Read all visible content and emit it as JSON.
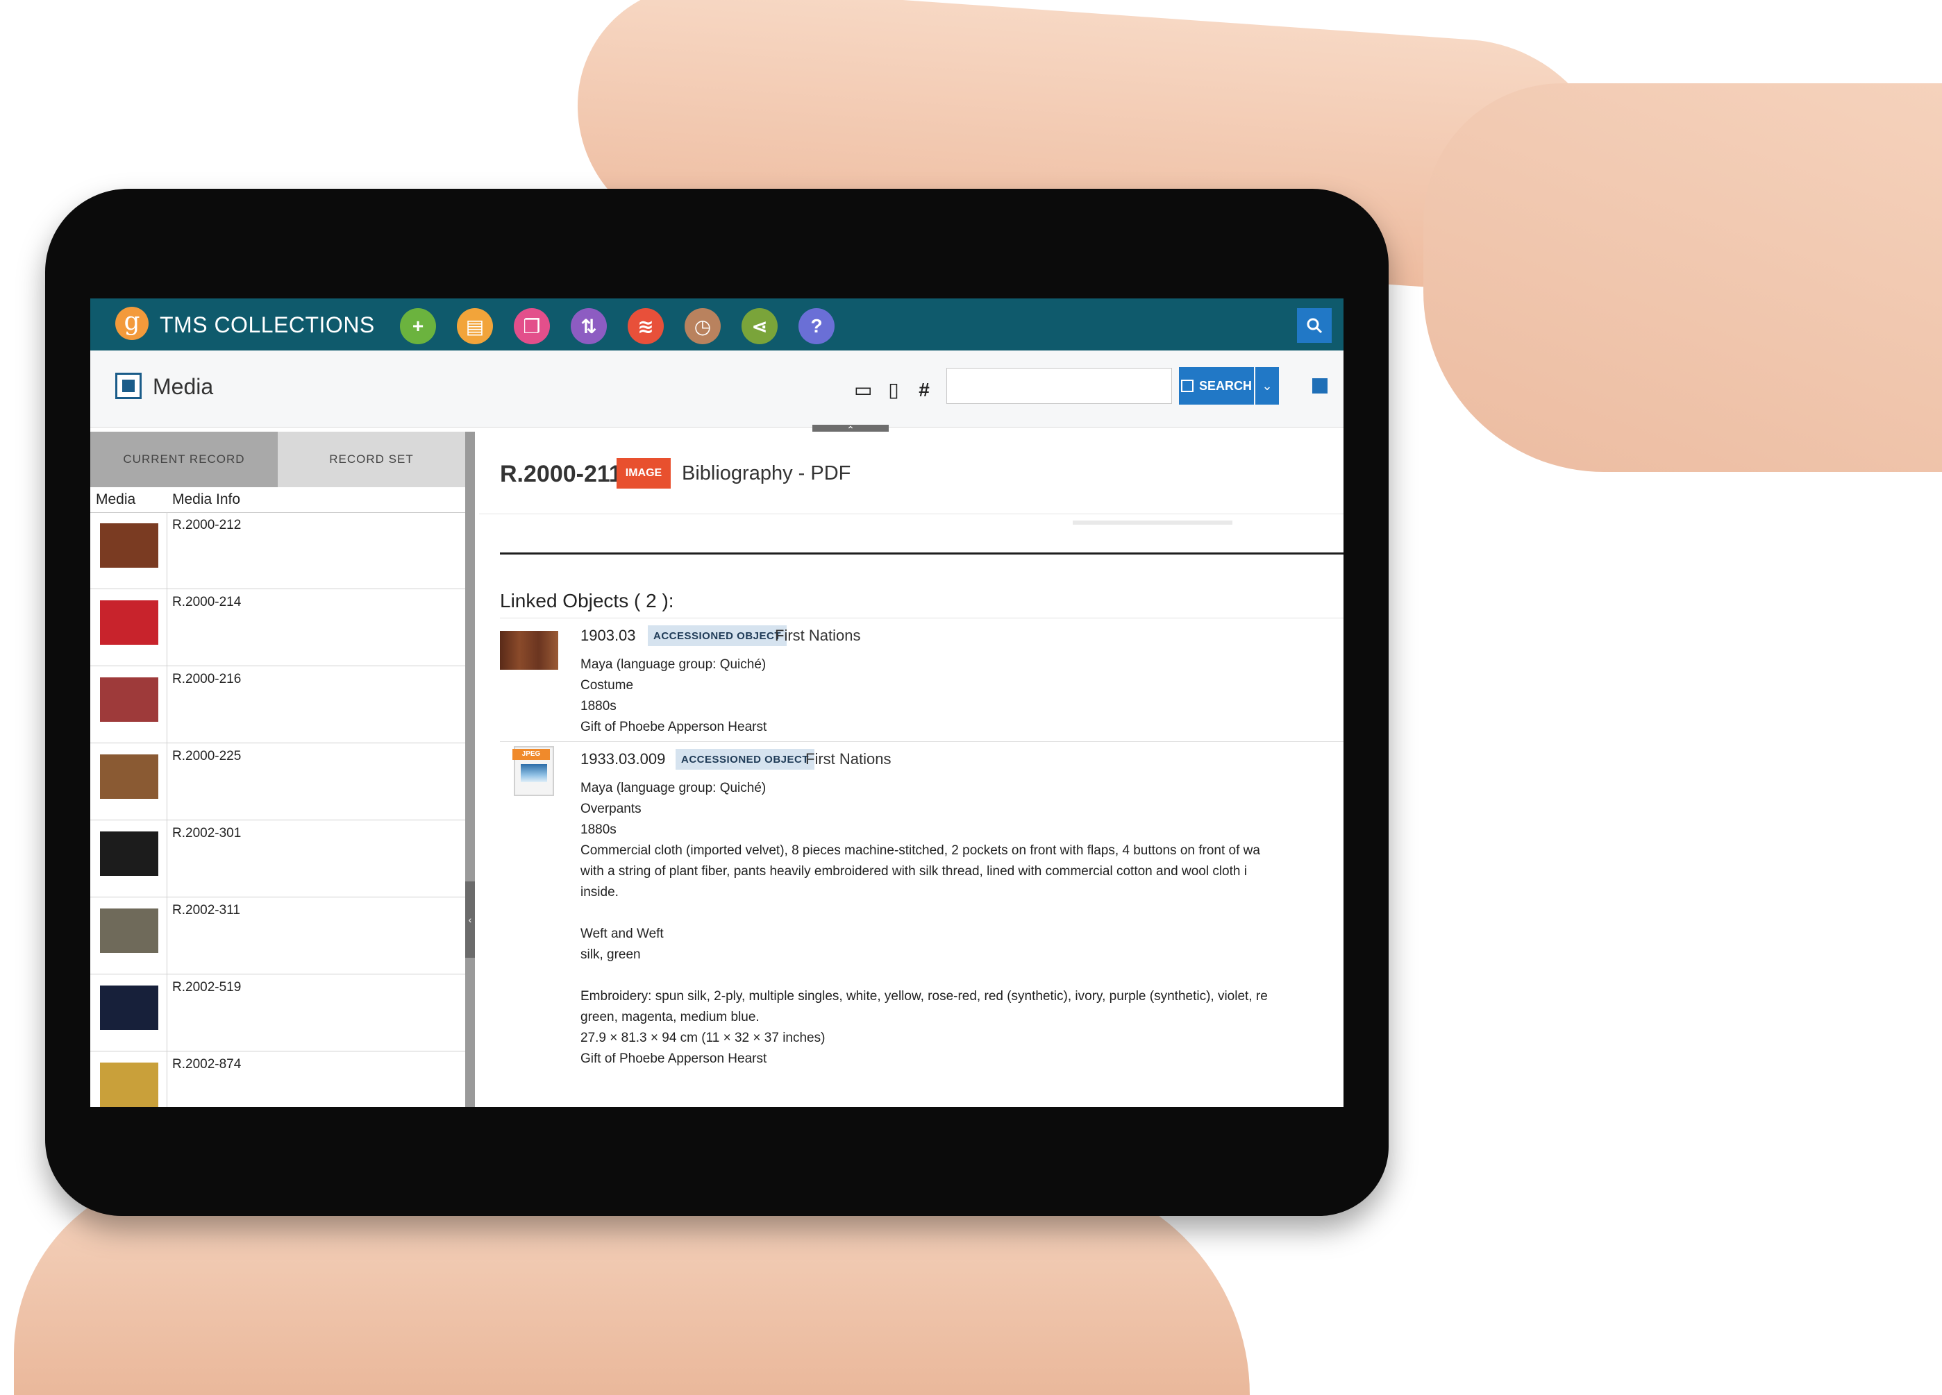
{
  "app": {
    "title": "TMS COLLECTIONS",
    "logo_letter": "g"
  },
  "toolbar": {
    "tools": [
      {
        "icon": "plus-icon",
        "glyph": "+",
        "color": "#6bb33e"
      },
      {
        "icon": "document-icon",
        "glyph": "▤",
        "color": "#f2a43a"
      },
      {
        "icon": "windows-icon",
        "glyph": "❐",
        "color": "#e34f8b"
      },
      {
        "icon": "sort-arrows-icon",
        "glyph": "⇅",
        "color": "#8d5cc2"
      },
      {
        "icon": "layers-icon",
        "glyph": "≋",
        "color": "#e8503a"
      },
      {
        "icon": "clock-icon",
        "glyph": "◷",
        "color": "#b9825e"
      },
      {
        "icon": "share-icon",
        "glyph": "⋖",
        "color": "#7aa43a"
      },
      {
        "icon": "help-icon",
        "glyph": "?",
        "color": "#6a6fd6"
      }
    ]
  },
  "header": {
    "title": "Media",
    "hash_symbol": "#",
    "search_value": "",
    "search_label": "SEARCH"
  },
  "left": {
    "tabs": [
      "CURRENT RECORD",
      "RECORD SET"
    ],
    "columns": [
      "Media",
      "Media Info"
    ],
    "items": [
      {
        "label": "R.2000-212",
        "swatch": "#7a3b22"
      },
      {
        "label": "R.2000-214",
        "swatch": "#c8232c"
      },
      {
        "label": "R.2000-216",
        "swatch": "#9e3a3a"
      },
      {
        "label": "R.2000-225",
        "swatch": "#8a5a33"
      },
      {
        "label": "R.2002-301",
        "swatch": "#1c1c1c"
      },
      {
        "label": "R.2002-311",
        "swatch": "#6f6a5a"
      },
      {
        "label": "R.2002-519",
        "swatch": "#17203a"
      },
      {
        "label": "R.2002-874",
        "swatch": "#c9a03a"
      }
    ]
  },
  "record": {
    "id": "R.2000-211",
    "type_badge": "IMAGE",
    "title": "Bibliography - PDF",
    "linked_heading": "Linked Objects ( 2 ):",
    "objects": [
      {
        "number": "1903.03",
        "badge": "ACCESSIONED OBJECT",
        "nation": "First Nations",
        "lines": [
          "Maya (language group: Quiché)",
          "Costume",
          "1880s",
          "Gift of Phoebe Apperson Hearst"
        ]
      },
      {
        "number": "1933.03.009",
        "badge": "ACCESSIONED OBJECT",
        "nation": "First Nations",
        "doc_tag": "JPEG",
        "lines": [
          "Maya (language group: Quiché)",
          "Overpants",
          "1880s",
          "Commercial cloth (imported velvet), 8 pieces machine-stitched, 2 pockets on front with flaps, 4 buttons on front of wa",
          "with a string of plant fiber, pants heavily embroidered with silk thread, lined with commercial cotton and wool cloth i",
          "inside.",
          "",
          "Weft and Weft",
          "silk, green",
          "",
          "Embroidery: spun silk, 2-ply, multiple singles, white, yellow, rose-red, red (synthetic), ivory, purple (synthetic), violet, re",
          "green, magenta, medium blue.",
          "27.9 × 81.3 × 94 cm (11 × 32 × 37 inches)",
          "Gift of Phoebe Apperson Hearst"
        ]
      }
    ]
  }
}
